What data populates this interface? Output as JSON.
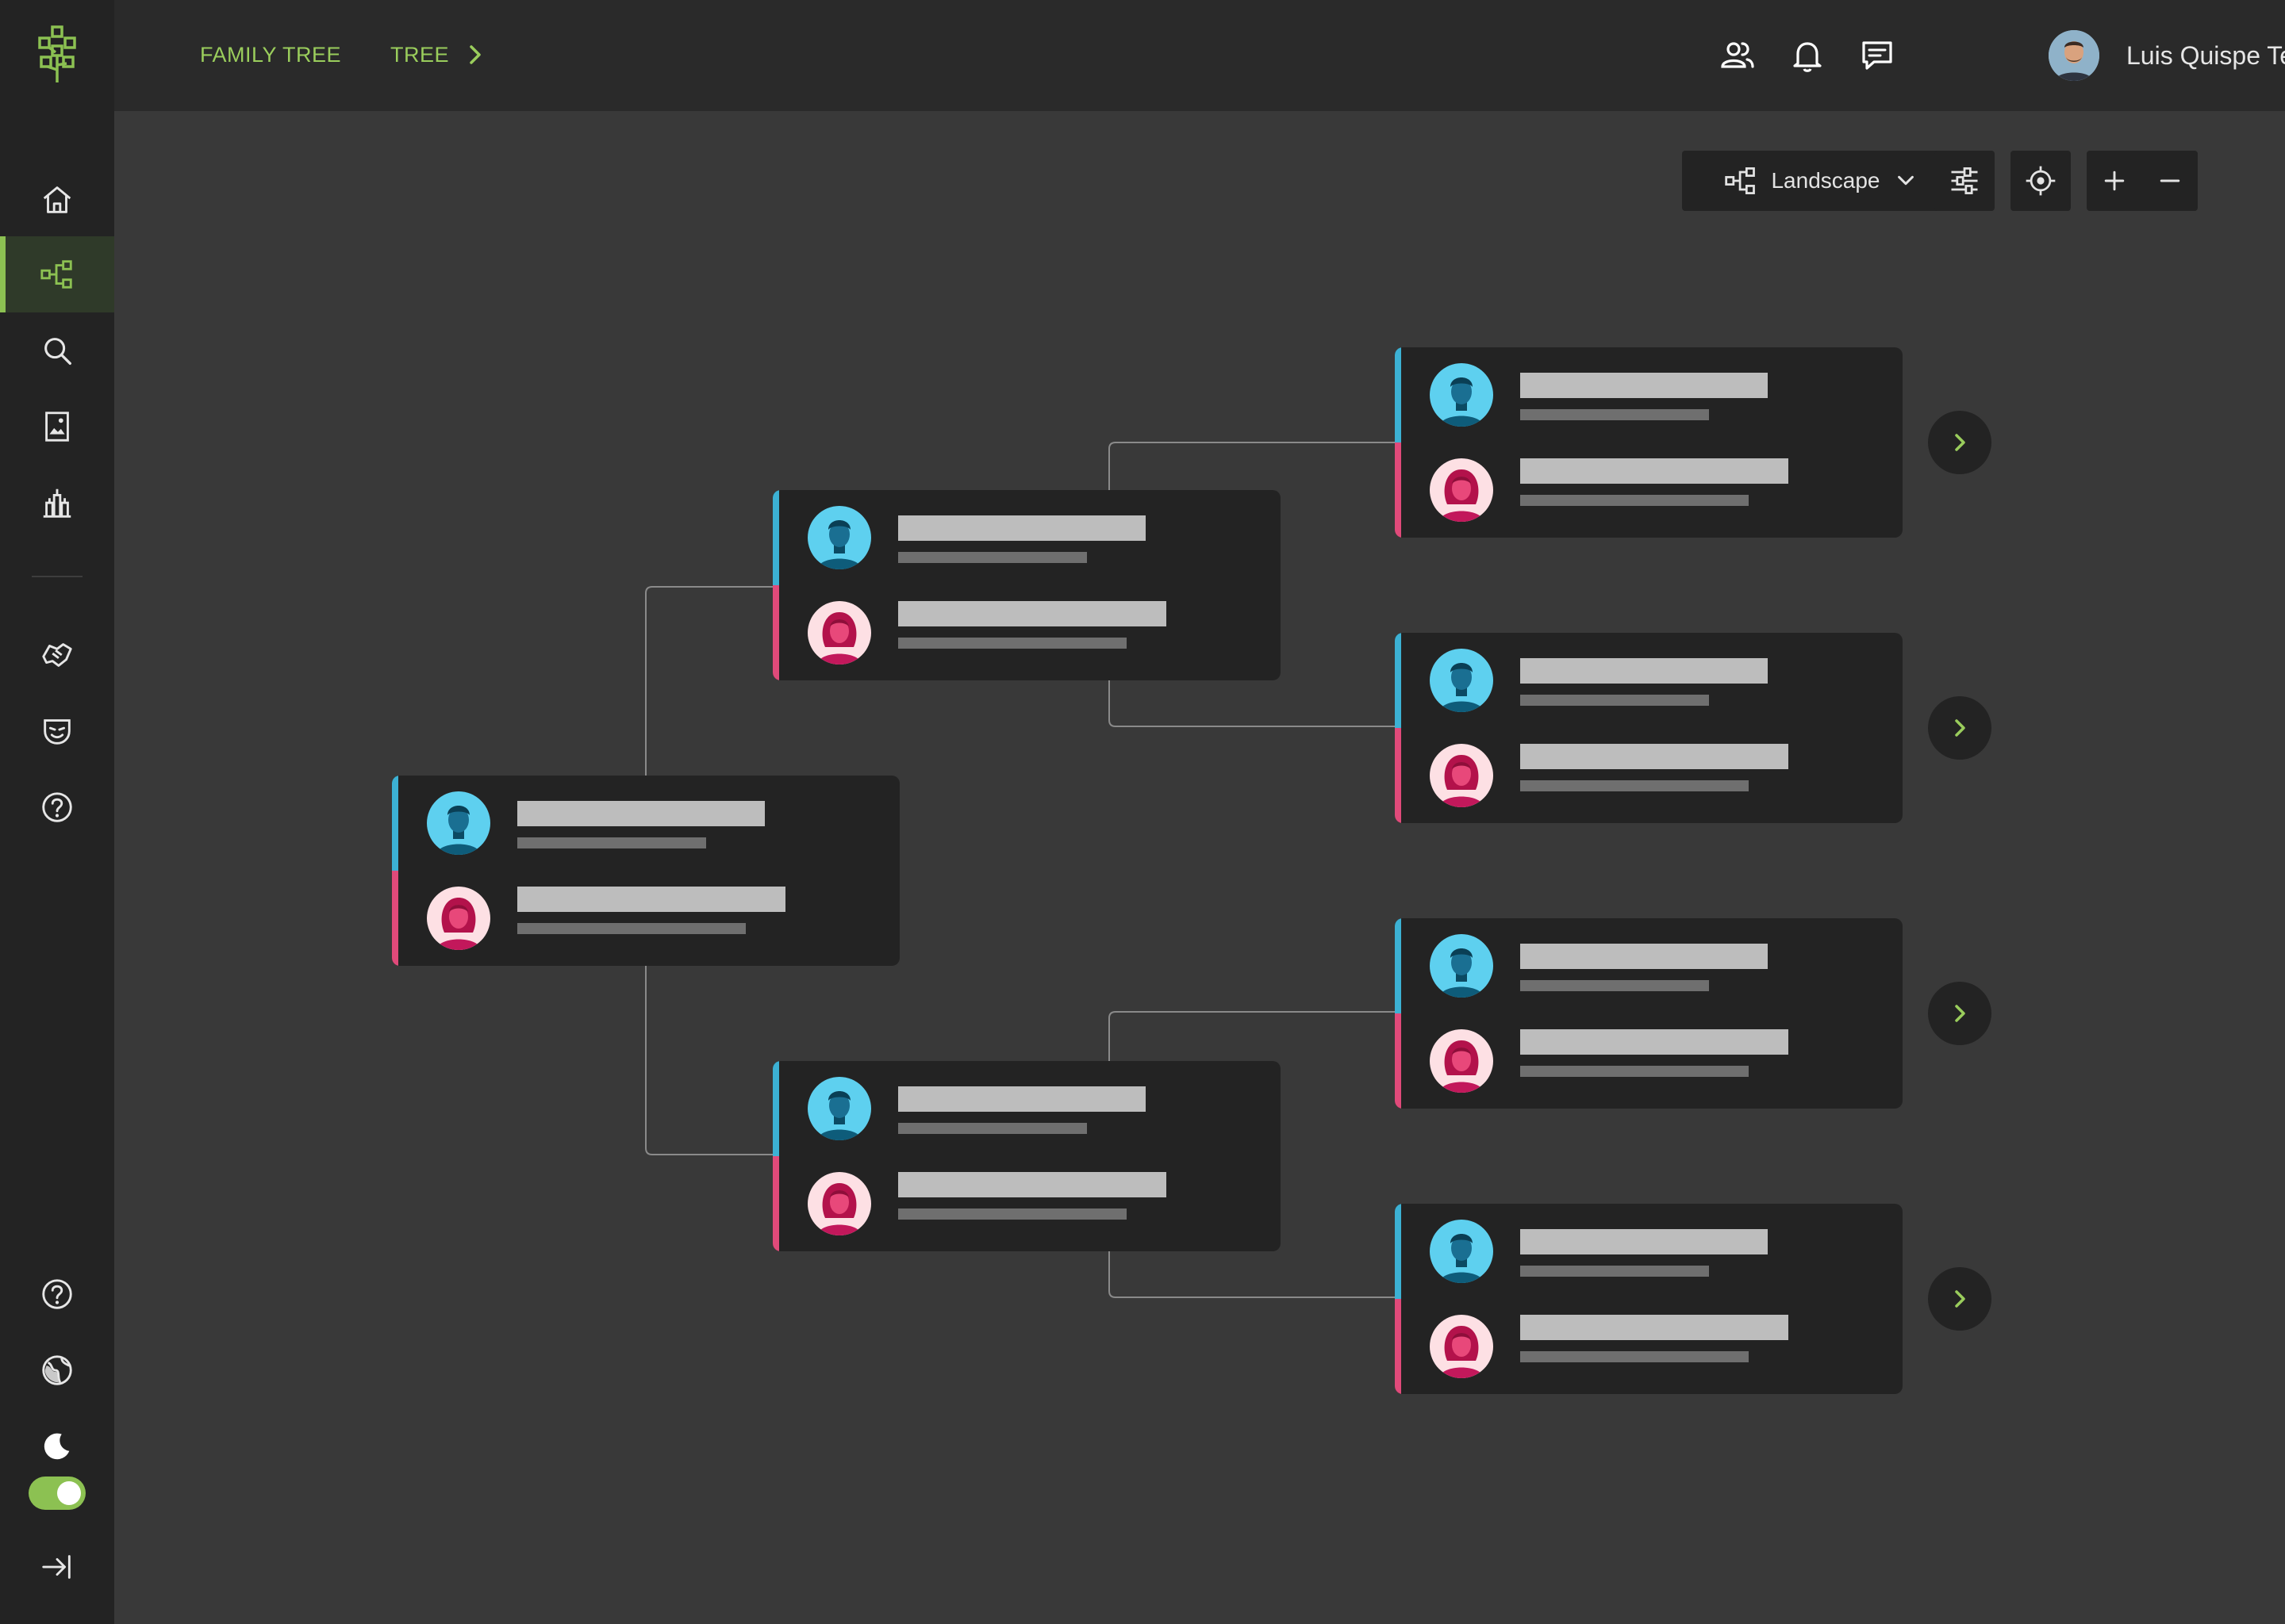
{
  "breadcrumb": {
    "items": [
      "FAMILY TREE",
      "TREE"
    ],
    "separator_icon": "chevron-right-icon"
  },
  "sidebar": {
    "logo": "tree-logo-icon",
    "nav": [
      {
        "icon": "home-icon",
        "active": false
      },
      {
        "icon": "family-tree-icon",
        "active": true
      },
      {
        "icon": "search-icon",
        "active": false
      },
      {
        "icon": "photo-album-icon",
        "active": false
      },
      {
        "icon": "monuments-icon",
        "active": false
      }
    ],
    "secondary": [
      {
        "icon": "handshake-icon"
      },
      {
        "icon": "mask-icon"
      },
      {
        "icon": "help-circle-icon"
      }
    ],
    "footer": [
      {
        "icon": "help-circle-icon"
      },
      {
        "icon": "globe-icon"
      },
      {
        "icon": "moon-icon"
      },
      {
        "icon": "collapse-sidebar-icon"
      }
    ],
    "dark_mode_enabled": true
  },
  "topbar": {
    "icons": [
      "people-icon",
      "bell-icon",
      "message-icon"
    ],
    "user": {
      "name": "Luis Quispe Tello",
      "avatar": "user-avatar"
    }
  },
  "toolbar": {
    "layout_label": "Landscape",
    "layout_icon": "layout-tree-icon",
    "buttons": [
      "filter-sliders-icon",
      "locate-icon",
      "zoom-in-icon",
      "zoom-out-icon"
    ]
  },
  "colors": {
    "accent": "#8cc152",
    "male": "#3cb1d4",
    "female": "#e04a7a",
    "card": "#232323",
    "canvas": "#393939"
  },
  "tree": {
    "generations": 3,
    "couples": [
      {
        "generation": 1
      },
      {
        "generation": 2
      },
      {
        "generation": 2
      },
      {
        "generation": 3
      },
      {
        "generation": 3
      },
      {
        "generation": 3
      },
      {
        "generation": 3
      }
    ]
  }
}
